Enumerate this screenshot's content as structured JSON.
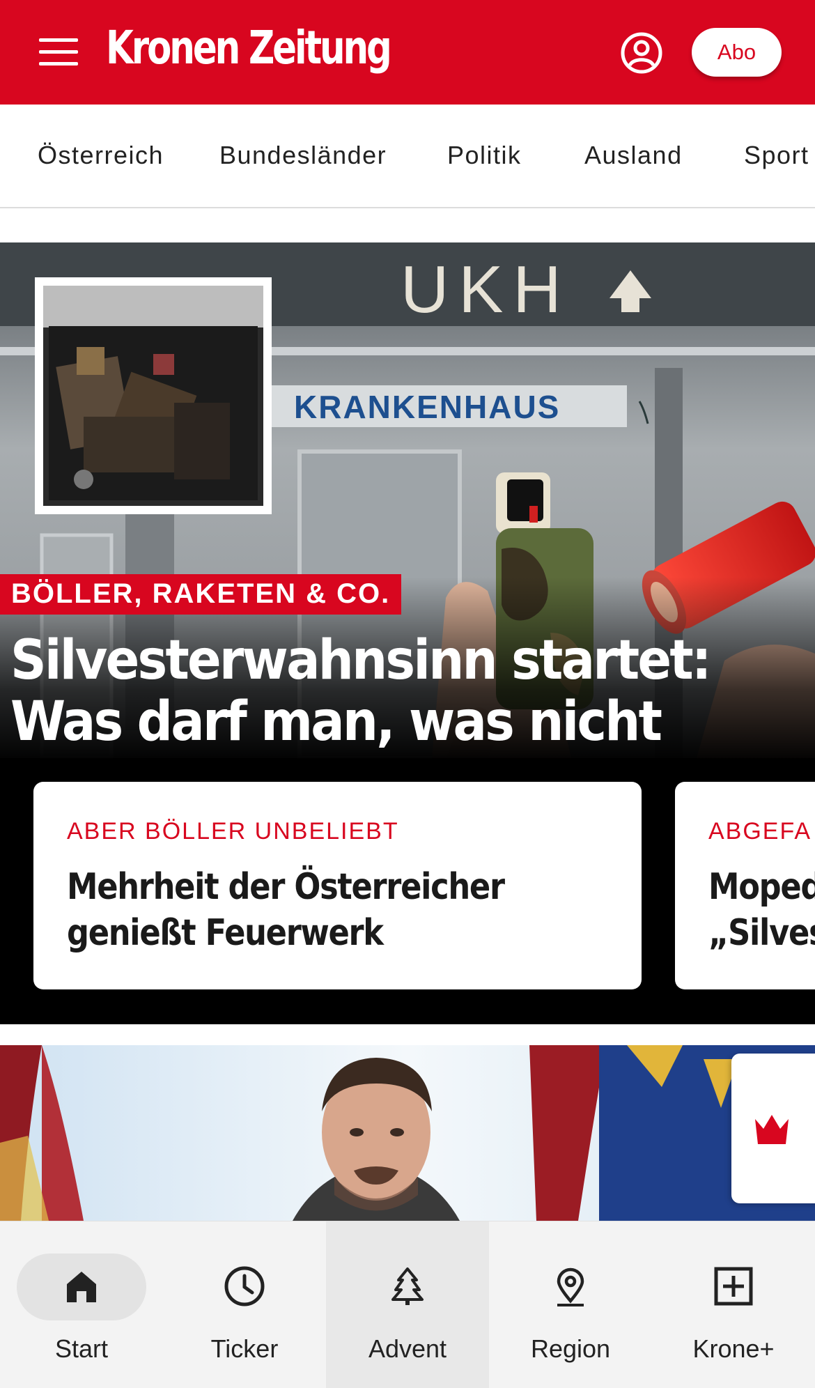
{
  "header": {
    "logo_text": "Kronen Zeitung",
    "abo_label": "Abo",
    "brand_color": "#d8061f"
  },
  "categories": [
    {
      "label": "Österreich"
    },
    {
      "label": "Bundesländer"
    },
    {
      "label": "Politik"
    },
    {
      "label": "Ausland"
    },
    {
      "label": "Sport"
    }
  ],
  "hero": {
    "image_sign_top": "UKH",
    "image_sign_building": "KRANKENHAUS",
    "kicker": "BÖLLER, RAKETEN & CO.",
    "headline": "Silvesterwahnsinn startet: Was darf man, was nicht",
    "subcards": [
      {
        "kicker": "ABER BÖLLER UNBELIEBT",
        "title_line1": "Mehrheit der Österreicher",
        "title_line2": "genießt Feuerwerk"
      },
      {
        "kicker": "ABGEFA",
        "title_line1": "Moped",
        "title_line2": "„Silves"
      }
    ]
  },
  "bottom_nav": [
    {
      "label": "Start",
      "icon": "home-icon"
    },
    {
      "label": "Ticker",
      "icon": "clock-icon"
    },
    {
      "label": "Advent",
      "icon": "tree-icon"
    },
    {
      "label": "Region",
      "icon": "location-pin-icon"
    },
    {
      "label": "Krone+",
      "icon": "plus-box-icon"
    }
  ]
}
